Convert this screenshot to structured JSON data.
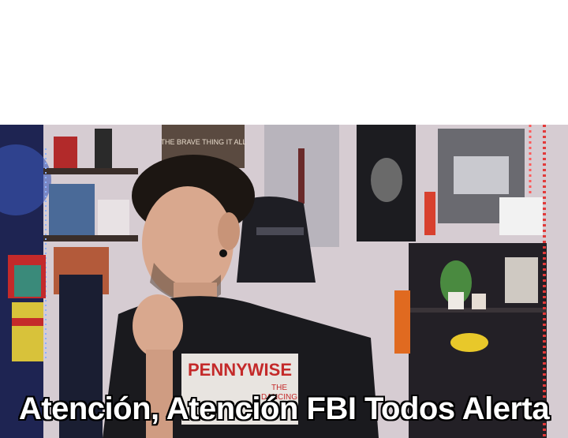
{
  "meme": {
    "caption": "Atención, Atención FBI Todos Alerta",
    "shirt_text": "PENNYWISE",
    "shirt_small_1": "THE",
    "shirt_small_2": "DANCING",
    "poster_top_text": "THE BRAVE THING IT ALL"
  },
  "colors": {
    "background_top": "#ffffff",
    "wall": "#d9cfd3",
    "shirt": "#1a1a1e",
    "caption_fill": "#ffffff",
    "caption_outline": "#000000",
    "led_red": "#e23a3a"
  }
}
